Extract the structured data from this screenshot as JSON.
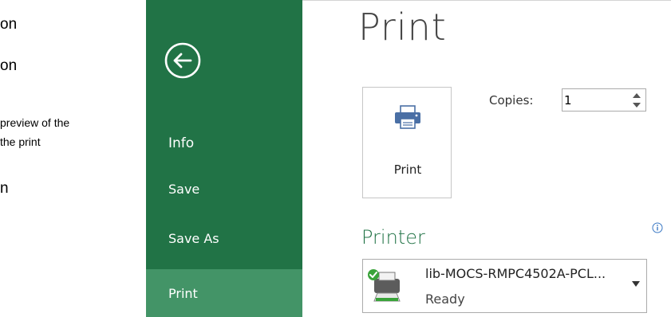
{
  "document_fragment": {
    "line1": "on",
    "line2": "on",
    "line3": "preview of the",
    "line4": "the print",
    "line5": "n"
  },
  "sidebar": {
    "items": [
      {
        "label": "Info"
      },
      {
        "label": "Save"
      },
      {
        "label": "Save As"
      },
      {
        "label": "Print",
        "selected": true
      }
    ],
    "accent": "#217346",
    "selected_color": "#439467"
  },
  "main": {
    "title": "Print",
    "print_button": {
      "label": "Print",
      "icon": "printer-icon"
    },
    "copies": {
      "label": "Copies:",
      "value": "1"
    },
    "printer_section": {
      "title": "Printer",
      "printer_name": "lib-MOCS-RMPC4502A-PCL...",
      "status": "Ready"
    }
  }
}
